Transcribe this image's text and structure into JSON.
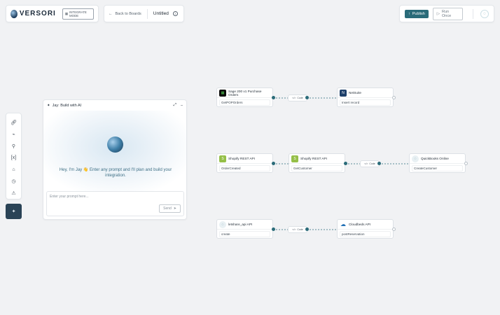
{
  "app": {
    "logo_text": "VERSORI",
    "mode_badge": "INTEGRATE MODE"
  },
  "breadcrumb": {
    "back_label": "Back to Boards",
    "title": "Untitled"
  },
  "actions": {
    "publish_label": "Publish",
    "run_once_label": "Run Once"
  },
  "toolbar": {
    "tools": [
      "link-icon",
      "plug-icon",
      "search-settings-icon",
      "variables-icon",
      "connection-icon",
      "history-icon",
      "warning-icon"
    ],
    "ai_tool": "sparkle-icon"
  },
  "chat": {
    "title": "Jay: Build with AI",
    "greeting": "Hey, I'm Jay 👋 Enter any prompt and I'll plan and build your integration.",
    "input_placeholder": "Enter your prompt here...",
    "send_label": "Send"
  },
  "flows": {
    "row1": {
      "source": {
        "title": "Sage 200 v1 Purchase Orders",
        "action": "GetPOPOrders"
      },
      "code": "Code",
      "target": {
        "title": "NetSuite",
        "action": "Insert record"
      }
    },
    "row2": {
      "source": {
        "title": "Shopify REST API",
        "action": "OrderCreated"
      },
      "middle": {
        "title": "Shopify REST API",
        "action": "GetCustomer"
      },
      "code": "Code",
      "target": {
        "title": "QuickBooks Online",
        "action": "CreateCustomer"
      }
    },
    "row3": {
      "source": {
        "title": "letshare_api API",
        "action": "create"
      },
      "code": "Code",
      "target": {
        "title": "Cloudbeds API",
        "action": "postReservation"
      }
    }
  },
  "colors": {
    "accent": "#2a6b79",
    "connector": "#2a6b79",
    "canvas": "#f1f2f4"
  }
}
